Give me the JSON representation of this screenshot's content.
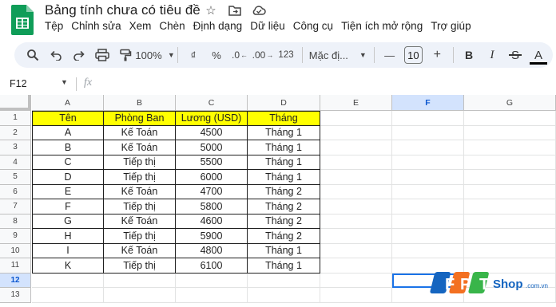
{
  "app": {
    "title": "Bảng tính chưa có tiêu đề",
    "title_icons": [
      "star-icon",
      "move-to-folder-icon",
      "cloud-status-icon"
    ]
  },
  "menu": [
    "Tệp",
    "Chỉnh sửa",
    "Xem",
    "Chèn",
    "Định dạng",
    "Dữ liệu",
    "Công cụ",
    "Tiện ích mở rộng",
    "Trợ giúp"
  ],
  "toolbar": {
    "zoom": "100%",
    "currency": "₫",
    "percent": "%",
    "dec_decrease": ".0",
    "dec_increase": ".00",
    "number_format": "123",
    "font": "Mặc đị...",
    "font_size": "10",
    "minus": "—",
    "plus": "+",
    "bold": "B",
    "italic": "I",
    "strike": "S",
    "text_color": "A"
  },
  "formula_bar": {
    "name_box": "F12",
    "fx": "fx"
  },
  "grid": {
    "columns": [
      "A",
      "B",
      "C",
      "D",
      "E",
      "F",
      "G"
    ],
    "selected_column": "F",
    "rows": [
      "1",
      "2",
      "3",
      "4",
      "5",
      "6",
      "7",
      "8",
      "9",
      "10",
      "11",
      "12",
      "13"
    ],
    "selected_row": "12",
    "active_cell": "F12",
    "header_fill": "#ffff00",
    "table_header": [
      "Tên",
      "Phòng Ban",
      "Lương (USD)",
      "Tháng"
    ],
    "table_rows": [
      [
        "A",
        "Kế Toán",
        "4500",
        "Tháng 1"
      ],
      [
        "B",
        "Kế Toán",
        "5000",
        "Tháng 1"
      ],
      [
        "C",
        "Tiếp thị",
        "5500",
        "Tháng 1"
      ],
      [
        "D",
        "Tiếp thị",
        "6000",
        "Tháng 1"
      ],
      [
        "E",
        "Kế Toán",
        "4700",
        "Tháng 2"
      ],
      [
        "F",
        "Tiếp thị",
        "5800",
        "Tháng 2"
      ],
      [
        "G",
        "Kế Toán",
        "4600",
        "Tháng 2"
      ],
      [
        "H",
        "Tiếp thị",
        "5900",
        "Tháng 2"
      ],
      [
        "I",
        "Kế Toán",
        "4800",
        "Tháng 1"
      ],
      [
        "K",
        "Tiếp thị",
        "6100",
        "Tháng 1"
      ]
    ]
  },
  "watermark": {
    "brand": "FPT",
    "site": "Shop",
    "domain": ".com.vn"
  },
  "colors": {
    "accent": "#1a73e8",
    "toolbar_bg": "#eef2f9",
    "selected_header": "#d3e3fd",
    "logo_blue": "#1565c0",
    "logo_orange": "#f37021",
    "logo_green": "#39b54a"
  }
}
